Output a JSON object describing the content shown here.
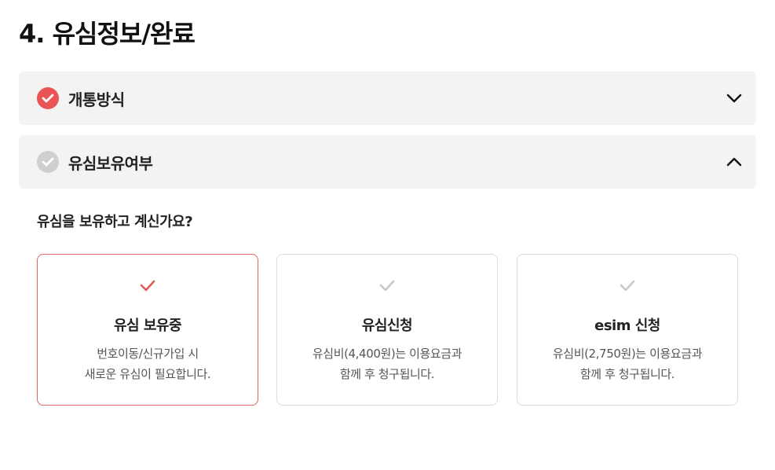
{
  "page": {
    "title": "4. 유심정보/완료"
  },
  "accordions": [
    {
      "label": "개통방식",
      "completed": true,
      "expanded": false,
      "icon": "chevron-down-icon"
    },
    {
      "label": "유심보유여부",
      "completed": false,
      "expanded": true,
      "icon": "chevron-up-icon"
    }
  ],
  "question": "유심을 보유하고 계신가요?",
  "options": [
    {
      "title": "유심 보유중",
      "desc_line1": "번호이동/신규가입 시",
      "desc_line2": "새로운 유심이 필요합니다.",
      "selected": true
    },
    {
      "title": "유심신청",
      "desc_line1": "유심비(4,400원)는 이용요금과",
      "desc_line2": "함께 후 청구됩니다.",
      "selected": false
    },
    {
      "title": "esim 신청",
      "desc_line1": "유심비(2,750원)는 이용요금과",
      "desc_line2": "함께 후 청구됩니다.",
      "selected": false
    }
  ],
  "colors": {
    "accent": "#ea5455",
    "inactive": "#cfcfcf",
    "panel": "#f3f3f3",
    "selected_border": "#e06666"
  }
}
